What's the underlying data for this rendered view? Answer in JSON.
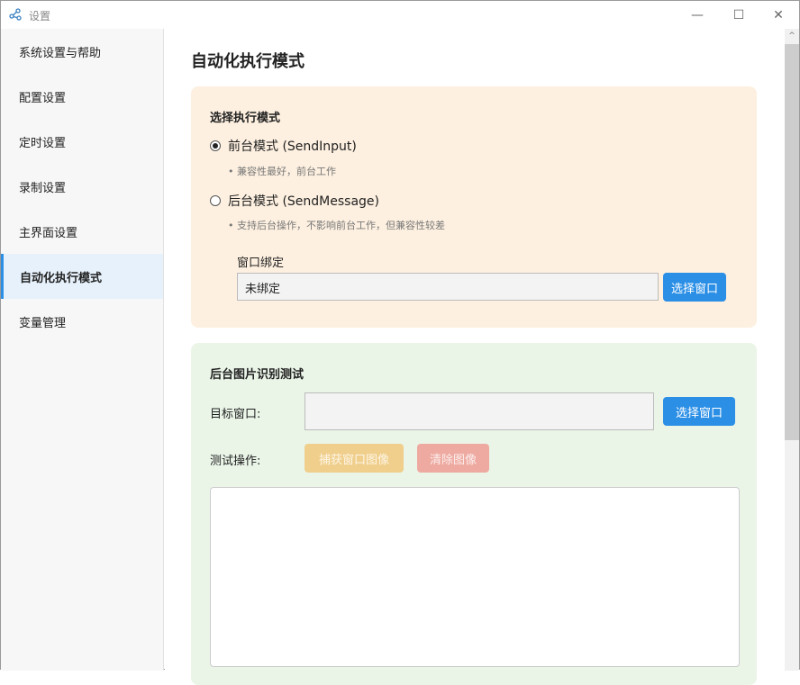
{
  "window": {
    "title": "设置",
    "minimize": "—",
    "maximize": "☐",
    "close": "✕"
  },
  "sidebar": {
    "items": [
      {
        "label": "系统设置与帮助"
      },
      {
        "label": "配置设置"
      },
      {
        "label": "定时设置"
      },
      {
        "label": "录制设置"
      },
      {
        "label": "主界面设置"
      },
      {
        "label": "自动化执行模式",
        "active": true
      },
      {
        "label": "变量管理"
      }
    ]
  },
  "main": {
    "title": "自动化执行模式",
    "mode": {
      "title": "选择执行模式",
      "options": [
        {
          "label": "前台模式 (SendInput)",
          "hint": "• 兼容性最好，前台工作",
          "selected": true
        },
        {
          "label": "后台模式 (SendMessage)",
          "hint": "• 支持后台操作，不影响前台工作，但兼容性较差",
          "selected": false
        }
      ],
      "bind_label": "窗口绑定",
      "bind_value": "未绑定",
      "select_button": "选择窗口"
    },
    "test": {
      "title": "后台图片识别测试",
      "target_label": "目标窗口:",
      "target_value": "",
      "select_button": "选择窗口",
      "ops_label": "测试操作:",
      "capture_button": "捕获窗口图像",
      "clear_button": "清除图像"
    }
  },
  "colors": {
    "accent": "#2b8fe6",
    "capture": "#f0cf8c",
    "clear": "#eeaaa0"
  }
}
